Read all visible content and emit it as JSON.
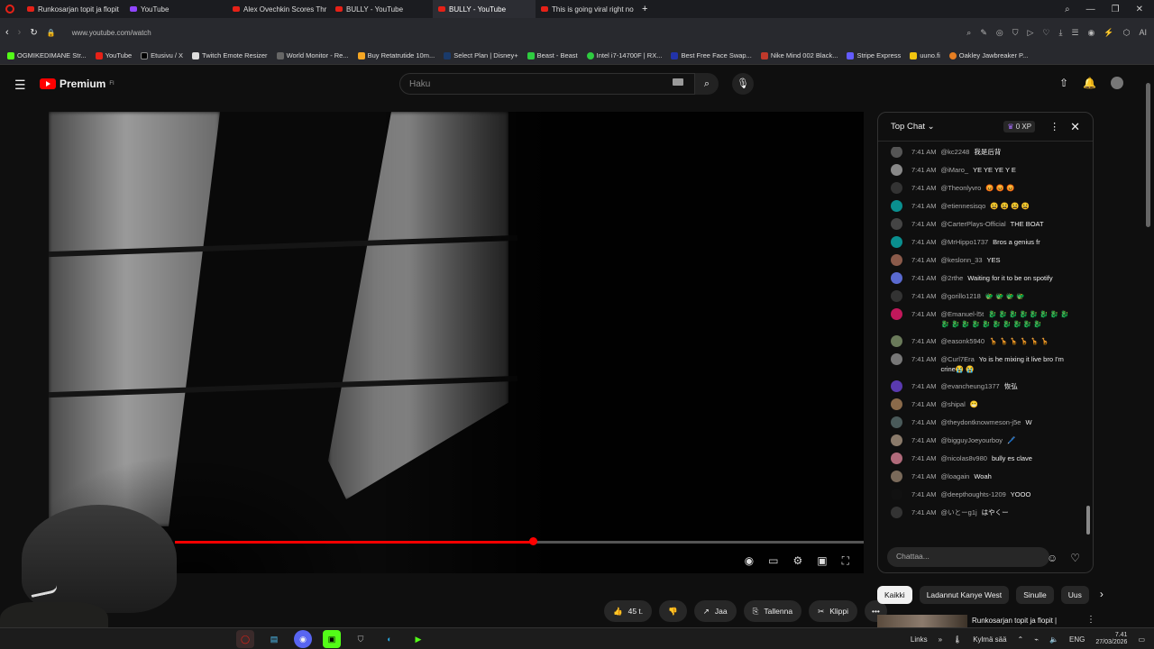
{
  "browser": {
    "tabs": [
      {
        "title": "Runkosarjan topit ja flopit",
        "active": false
      },
      {
        "title": "YouTube",
        "active": false
      },
      {
        "title": "Alex Ovechkin Scores Thr",
        "active": false
      },
      {
        "title": "BULLY - YouTube",
        "active": false
      },
      {
        "title": "BULLY - YouTube",
        "active": true
      },
      {
        "title": "This is going viral right no",
        "active": false
      }
    ],
    "url": "www.youtube.com/watch",
    "bookmarks": [
      "OGMIKEDIMANE Str...",
      "YouTube",
      "Etusivu / X",
      "Twitch Emote Resizer",
      "World Monitor - Re...",
      "Buy Retatrutide 10m...",
      "Select Plan | Disney+",
      "Beast - Beast",
      "Intel i7-14700F | RX...",
      "Best Free Face Swap...",
      "Nike Mind 002 Black...",
      "Stripe Express",
      "uuno.fi",
      "Oakley Jawbreaker P..."
    ]
  },
  "header": {
    "logo": "Premium",
    "logo_sup": "FI",
    "search_placeholder": "Haku"
  },
  "player": {
    "progress": 0.52
  },
  "chat": {
    "mode": "Top Chat",
    "xp": "0 XP",
    "input_placeholder": "Chattaa...",
    "messages": [
      {
        "time": "7:41 AM",
        "user": "@kc2248",
        "text": "我是后背",
        "color": "#555"
      },
      {
        "time": "7:41 AM",
        "user": "@iMaro_",
        "text": "YE YE YE Y E",
        "color": "#888"
      },
      {
        "time": "7:41 AM",
        "user": "@Theonlyvro",
        "text": "😡 😡 😡",
        "color": "#333"
      },
      {
        "time": "7:41 AM",
        "user": "@etiennesisqo",
        "text": "😫 😫 😫 😫",
        "color": "#0a8f8f"
      },
      {
        "time": "7:41 AM",
        "user": "@CarterPlays-Official",
        "text": "THE BOAT",
        "color": "#444"
      },
      {
        "time": "7:41 AM",
        "user": "@MrHippo1737",
        "text": "Bros a genius fr",
        "color": "#0a8f8f"
      },
      {
        "time": "7:41 AM",
        "user": "@keslonn_33",
        "text": "YES",
        "color": "#8a5a4a"
      },
      {
        "time": "7:41 AM",
        "user": "@2rthe",
        "text": "Waiting for it to be on spotify",
        "color": "#5a6ad0"
      },
      {
        "time": "7:41 AM",
        "user": "@gorillo1218",
        "text": "🐲 🐲 🐲 🐲",
        "color": "#333"
      },
      {
        "time": "7:41 AM",
        "user": "@Emanuel-l5t",
        "text": "🐉 🐉 🐉 🐉 🐉 🐉 🐉 🐉 🐉 🐉 🐉 🐉 🐉 🐉 🐉 🐉 🐉 🐉",
        "color": "#c2185b"
      },
      {
        "time": "7:41 AM",
        "user": "@easonk5940",
        "text": "🦒 🦒 🦒 🦒 🦒 🦒",
        "color": "#6a7a5a"
      },
      {
        "time": "7:41 AM",
        "user": "@Curl7Era",
        "text": "Yo is he mixing it live bro I'm crine😭 😭",
        "color": "#777"
      },
      {
        "time": "7:41 AM",
        "user": "@evancheung1377",
        "text": "恢弘",
        "color": "#5a3ab0"
      },
      {
        "time": "7:41 AM",
        "user": "@shipal",
        "text": "😬",
        "color": "#8a6a4a"
      },
      {
        "time": "7:41 AM",
        "user": "@theydontknowmeson-j5e",
        "text": "W",
        "color": "#4a5a5a"
      },
      {
        "time": "7:41 AM",
        "user": "@bigguyJoeyourboy",
        "text": "🖊️",
        "color": "#8a7a6a"
      },
      {
        "time": "7:41 AM",
        "user": "@nicolas8v980",
        "text": "bully es clave",
        "color": "#b06a7a"
      },
      {
        "time": "7:41 AM",
        "user": "@loagain",
        "text": "Woah",
        "color": "#7a6a5a"
      },
      {
        "time": "7:41 AM",
        "user": "@deepthoughts-1209",
        "text": "YOOO",
        "color": "#111"
      },
      {
        "time": "7:41 AM",
        "user": "@いとーg1j",
        "text": "はやくー",
        "color": "#333"
      }
    ]
  },
  "actions": {
    "like": "45 t.",
    "share": "Jaa",
    "save": "Tallenna",
    "clip": "Klippi"
  },
  "chips": [
    "Kaikki",
    "Ladannut Kanye West",
    "Sinulle",
    "Uus"
  ],
  "recommendation": {
    "title": "Runkosarjan topit ja flopit |"
  },
  "taskbar": {
    "links": "Links",
    "weather": "Kylmä sää",
    "lang": "ENG",
    "time": "7.41",
    "date": "27/03/2026"
  }
}
